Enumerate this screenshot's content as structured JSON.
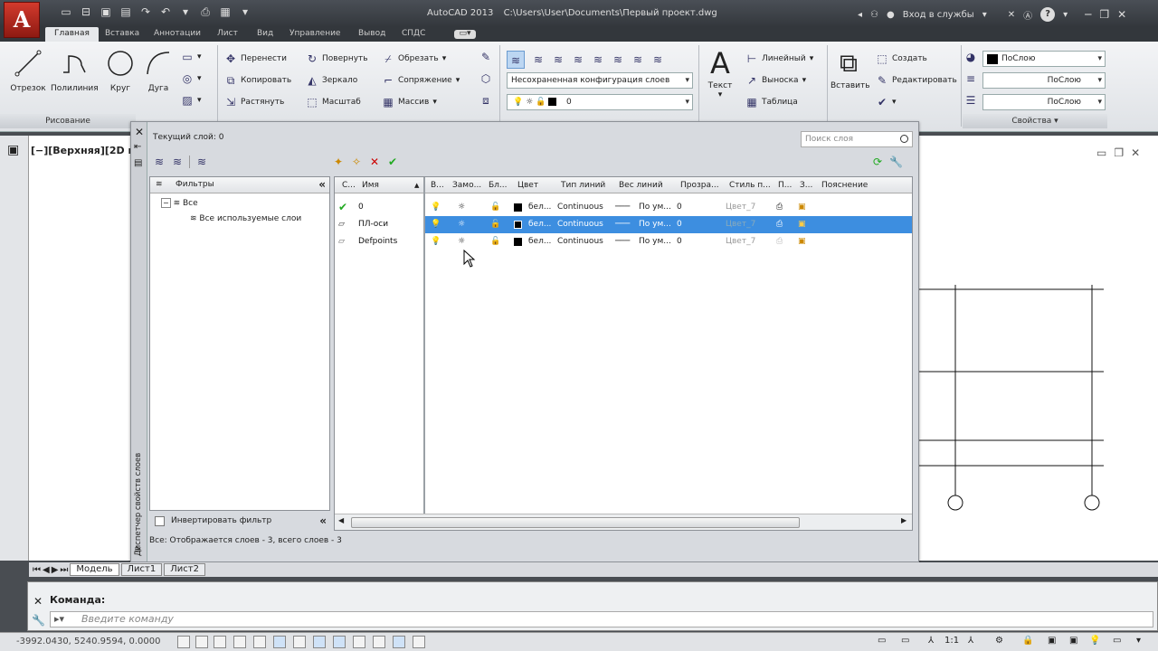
{
  "app": {
    "title": "AutoCAD 2013",
    "path": "C:\\Users\\User\\Documents\\Первый проект.dwg",
    "logo": "A",
    "signin": "Вход в службы"
  },
  "ribbon_tabs": [
    "Главная",
    "Вставка",
    "Аннотации",
    "Лист",
    "Вид",
    "Управление",
    "Вывод",
    "СПДС"
  ],
  "draw": {
    "line": "Отрезок",
    "polyline": "Полилиния",
    "circle": "Круг",
    "arc": "Дуга",
    "panel": "Рисование"
  },
  "modify": {
    "move": "Перенести",
    "rotate": "Повернуть",
    "trim": "Обрезать",
    "copy": "Копировать",
    "mirror": "Зеркало",
    "fillet": "Сопряжение",
    "stretch": "Растянуть",
    "scale": "Масштаб",
    "array": "Массив"
  },
  "layers_panel": {
    "config": "Несохраненная конфигурация слоев",
    "current": "0"
  },
  "annotation": {
    "text": "Текст",
    "linear": "Линейный",
    "leader": "Выноска",
    "table": "Таблица"
  },
  "block": {
    "insert": "Вставить",
    "create": "Создать",
    "edit": "Редактировать"
  },
  "properties": {
    "bylayer1": "ПоСлою",
    "bylayer2": "ПоСлою",
    "bylayer3": "ПоСлою",
    "panel": "Свойства"
  },
  "viewport": {
    "label": "[−][Верхняя][2D кар"
  },
  "layer_manager": {
    "current_layer": "Текущий слой: 0",
    "search_placeholder": "Поиск слоя",
    "filters_header": "Фильтры",
    "tree_all": "Все",
    "tree_used": "Все используемые слои",
    "invert": "Инвертировать фильтр",
    "side_title": "Диспетчер свойств слоев",
    "status": "Все: Отображается слоев - 3, всего слоев - 3",
    "columns": [
      "С...",
      "Имя",
      "В...",
      "Замо...",
      "Бл...",
      "Цвет",
      "Тип линий",
      "Вес линий",
      "Прозра...",
      "Стиль п...",
      "П...",
      "З...",
      "Пояснение"
    ],
    "rows": [
      {
        "name": "0",
        "color": "бел...",
        "linetype": "Continuous",
        "weight": "По ум...",
        "transparency": "0",
        "plotstyle": "Цвет_7"
      },
      {
        "name": "ПЛ-оси",
        "color": "бел...",
        "linetype": "Continuous",
        "weight": "По ум...",
        "transparency": "0",
        "plotstyle": "Цвет_7"
      },
      {
        "name": "Defpoints",
        "color": "бел...",
        "linetype": "Continuous",
        "weight": "По ум...",
        "transparency": "0",
        "plotstyle": "Цвет_7"
      }
    ]
  },
  "sheets": [
    "Модель",
    "Лист1",
    "Лист2"
  ],
  "command": {
    "label": "Команда:",
    "placeholder": "Введите команду"
  },
  "status": {
    "coords": "-3992.0430, 5240.9594, 0.0000",
    "scale": "1:1"
  }
}
